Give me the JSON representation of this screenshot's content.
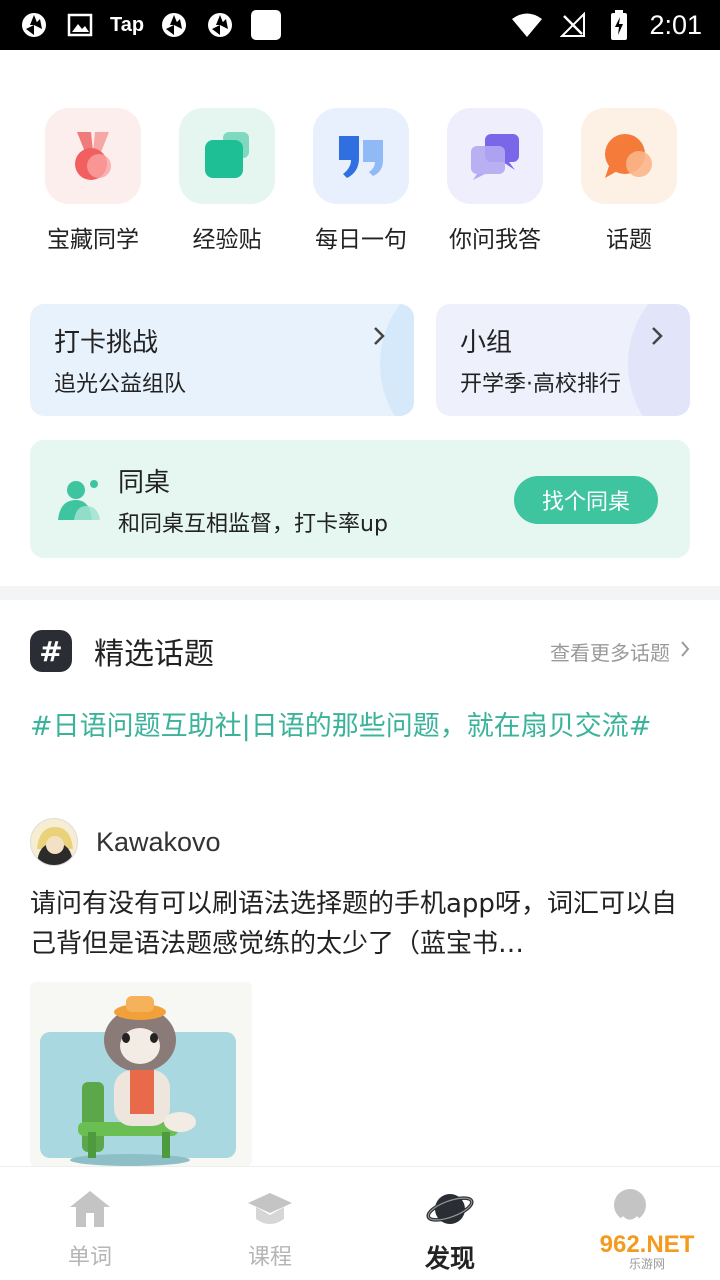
{
  "status_bar": {
    "carrier_text": "Tap",
    "time": "2:01"
  },
  "quick_entries": [
    {
      "label": "宝藏同学",
      "icon": "medal-icon",
      "bg": "#fdeeee"
    },
    {
      "label": "经验贴",
      "icon": "notes-icon",
      "bg": "#e4f6ef"
    },
    {
      "label": "每日一句",
      "icon": "quote-icon",
      "bg": "#e9f0fd"
    },
    {
      "label": "你问我答",
      "icon": "chat-bubbles-icon",
      "bg": "#efeefd"
    },
    {
      "label": "话题",
      "icon": "topic-bubble-icon",
      "bg": "#fdf1e6"
    }
  ],
  "cards": {
    "checkin": {
      "title": "打卡挑战",
      "subtitle": "追光公益组队"
    },
    "group": {
      "title": "小组",
      "subtitle": "开学季·高校排行"
    },
    "desk": {
      "title": "同桌",
      "subtitle": "和同桌互相监督，打卡率up",
      "button": "找个同桌"
    }
  },
  "topics": {
    "section_title": "精选话题",
    "more_label": "查看更多话题",
    "tag": "#日语问题互助社|日语的那些问题，就在扇贝交流#",
    "post": {
      "author": "Kawakovo",
      "text": "请问有没有可以刷语法选择题的手机app呀，词汇可以自己背但是语法题感觉练的太少了（蓝宝书…"
    }
  },
  "bottom_nav": [
    {
      "label": "单词",
      "icon": "house-icon",
      "active": false
    },
    {
      "label": "课程",
      "icon": "graduation-cap-icon",
      "active": false
    },
    {
      "label": "发现",
      "icon": "planet-icon",
      "active": true
    },
    {
      "label": "",
      "icon": "profile-icon",
      "active": false
    }
  ],
  "watermark": {
    "main": "962.NET",
    "sub": "乐游网"
  },
  "colors": {
    "accent": "#3bb39a",
    "button": "#3fc4a0",
    "desk_bg": "#e6f6f0"
  }
}
